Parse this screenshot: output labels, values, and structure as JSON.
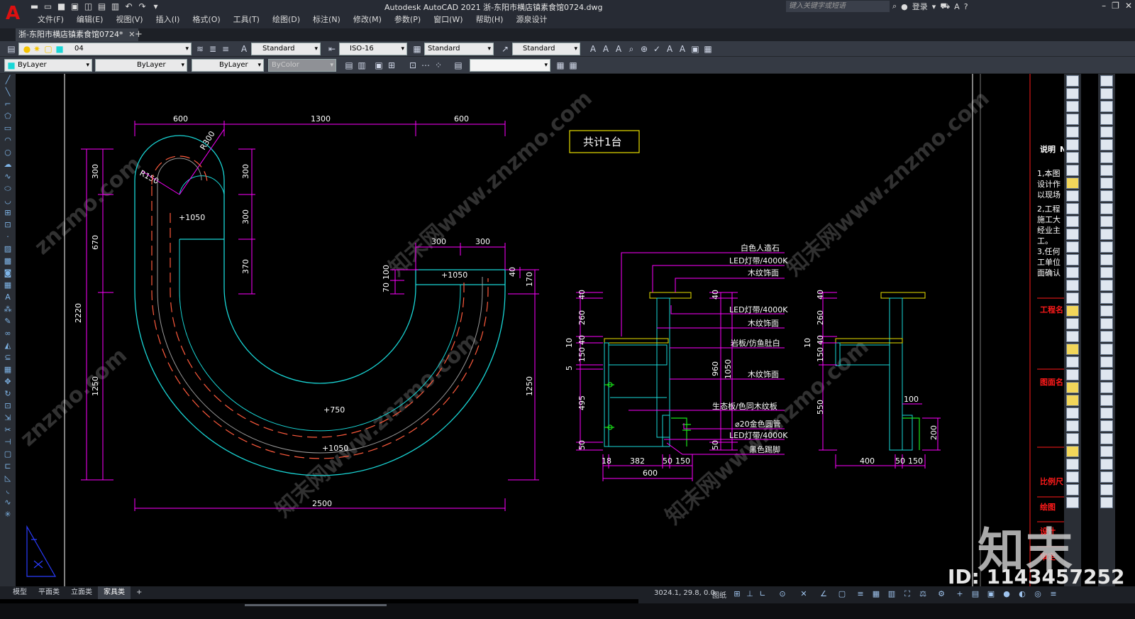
{
  "app": {
    "title": "Autodesk AutoCAD 2021    浙-东阳市横店镇素食馆0724.dwg",
    "logo": "A",
    "search_placeholder": "键入关键字或短语",
    "login": "登录"
  },
  "menu": [
    "文件(F)",
    "编辑(E)",
    "视图(V)",
    "插入(I)",
    "格式(O)",
    "工具(T)",
    "绘图(D)",
    "标注(N)",
    "修改(M)",
    "参数(P)",
    "窗口(W)",
    "帮助(H)",
    "源泉设计"
  ],
  "doc_tab": "浙-东阳市横店镇素食馆0724*",
  "toolbar": {
    "layer": "04",
    "text_style": "Standard",
    "dim_style": "ISO-16",
    "table_style": "Standard",
    "mleader_style": "Standard",
    "color": "ByLayer",
    "linetype": "ByLayer",
    "lineweight": "ByLayer",
    "plotstyle": "ByColor"
  },
  "drawing": {
    "plan": {
      "dims_top": [
        "600",
        "1300",
        "600"
      ],
      "dim_bottom": "2500",
      "dims_left_outer": "2220",
      "dims_left_inner": [
        "300",
        "670",
        "1250"
      ],
      "dims_mid": [
        "300",
        "300",
        "370"
      ],
      "dims_right_top": [
        "300",
        "300"
      ],
      "dims_right_small": [
        "70",
        "100"
      ],
      "dims_right": [
        "40",
        "170",
        "1250"
      ],
      "radius_1": "R300",
      "radius_2": "R150",
      "levels": [
        "+1050",
        "+1050",
        "+750",
        "+1050"
      ]
    },
    "count_label": "共计1台",
    "section": {
      "labels": [
        "白色人造石",
        "LED灯带/4000K",
        "木纹饰面",
        "LED灯带/4000K",
        "木纹饰面",
        "岩板/仿鱼肚白",
        "木纹饰面",
        "生态板/色同木纹板",
        "⌀20金色圆管",
        "LED灯带/4000K",
        "黑色踢脚"
      ],
      "dims_left": [
        "40",
        "260",
        "10",
        "40",
        "150",
        "5",
        "495",
        "50"
      ],
      "dims_right": [
        "40",
        "960",
        "1050",
        "50"
      ],
      "dims_bottom": [
        "18",
        "382",
        "50",
        "150"
      ],
      "dim_total": "600"
    },
    "side": {
      "dims_left": [
        "40",
        "260",
        "10",
        "40",
        "150",
        "550"
      ],
      "dims_right": [
        "100",
        "200"
      ],
      "dims_bottom": [
        "400",
        "50",
        "150"
      ]
    },
    "notes": {
      "title": "说明",
      "title_suffix": "N",
      "lines": [
        "1,本图",
        "设计作",
        "以现场",
        "2,工程",
        "施工大",
        "经业主",
        "工。",
        "3,任何",
        "工单位",
        "面确认"
      ],
      "fields": [
        "工程名",
        "图面名",
        "比例尺",
        "绘图",
        "设计",
        "审定"
      ]
    }
  },
  "layout_tabs": [
    "模型",
    "平面类",
    "立面类",
    "家具类"
  ],
  "active_layout": "家具类",
  "status": {
    "coords": "3024.1, 29.8, 0.0",
    "mode": "图纸"
  },
  "watermark": {
    "logo": "知末",
    "id": "ID: 1143457252",
    "site": "znzmo.com",
    "site_cn": "知末网www.znzmo.com"
  },
  "colors": {
    "cyan": "#19d7d7",
    "magenta": "#ff00ff",
    "yellow": "#e8e000",
    "red_dash": "#ff5a3c",
    "green": "#19e619",
    "white": "#ffffff",
    "red": "#ff1a1a"
  }
}
